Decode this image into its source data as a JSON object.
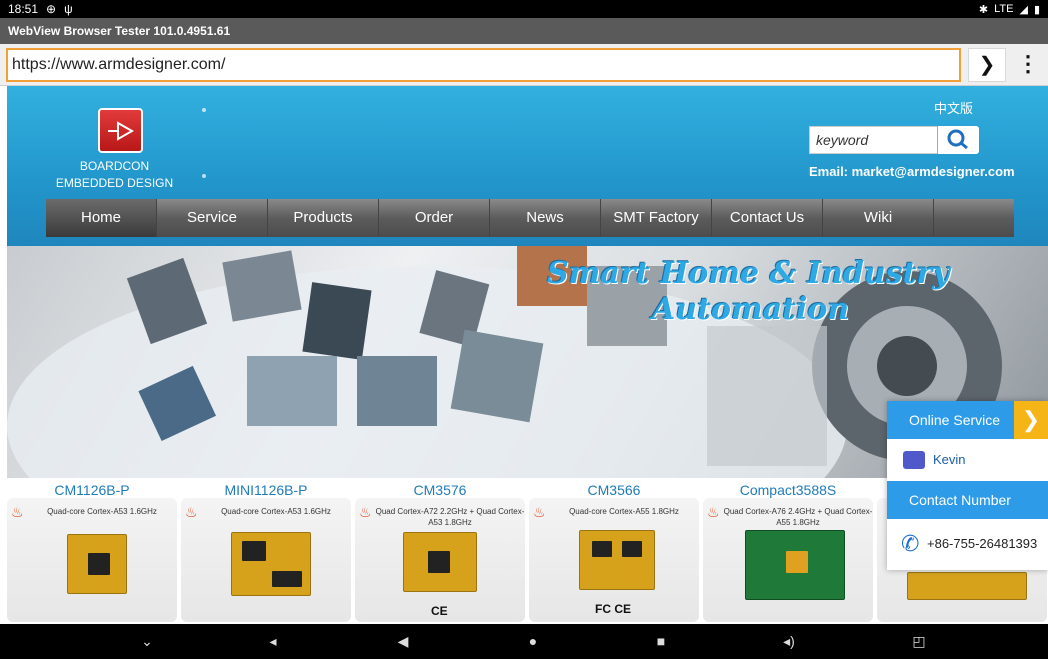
{
  "status_bar": {
    "time": "18:51",
    "network": "LTE"
  },
  "app": {
    "title": "WebView Browser Tester 101.0.4951.61"
  },
  "url_bar": {
    "value": "https://www.armdesigner.com/",
    "go_glyph": "❯",
    "menu_glyph": "⋮"
  },
  "site": {
    "brand_line1": "BOARDCON",
    "brand_line2": "EMBEDDED DESIGN",
    "language_link": "中文版",
    "search_placeholder": "keyword",
    "email": "Email: market@armdesigner.com",
    "nav": [
      "Home",
      "Service",
      "Products",
      "Order",
      "News",
      "SMT Factory",
      "Contact Us",
      "Wiki"
    ],
    "banner_title_line1": "Smart Home & Industry",
    "banner_title_line2": "Automation"
  },
  "products": [
    {
      "name": "CM1126B-P",
      "spec": "Quad-core Cortex-A53 1.6GHz",
      "cert": ""
    },
    {
      "name": "MINI1126B-P",
      "spec": "Quad-core Cortex-A53 1.6GHz",
      "cert": ""
    },
    {
      "name": "CM3576",
      "spec": "Quad Cortex-A72 2.2GHz + Quad Cortex-A53 1.8GHz",
      "cert": "CE"
    },
    {
      "name": "CM3566",
      "spec": "Quad-core Cortex-A55 1.8GHz",
      "cert": "FC CE"
    },
    {
      "name": "Compact3588S",
      "spec": "Quad Cortex-A76 2.4GHz + Quad Cortex-A55 1.8GHz",
      "cert": ""
    }
  ],
  "service_widget": {
    "header": "Online Service",
    "agent": "Kevin",
    "contact_header": "Contact Number",
    "phone": "+86-755-26481393"
  },
  "colors": {
    "header_blue": "#2296cb",
    "accent_orange": "#f0a036",
    "service_blue": "#2d9be8",
    "product_blue": "#1f7bb9"
  }
}
